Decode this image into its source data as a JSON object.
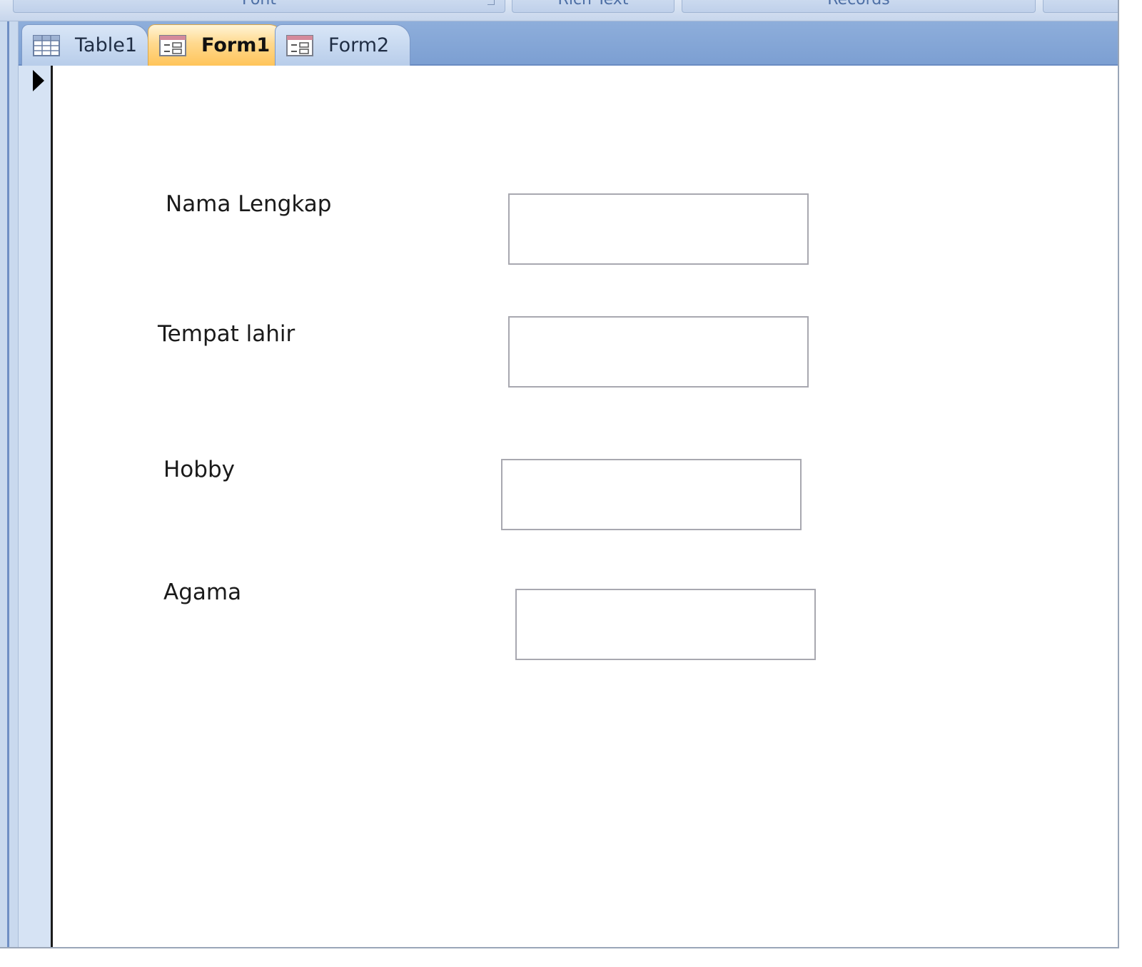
{
  "ribbon": {
    "groups": [
      "Font",
      "Rich Text",
      "Records"
    ]
  },
  "tabs": [
    {
      "label": "Table1",
      "icon": "table-icon",
      "active": false
    },
    {
      "label": "Form1",
      "icon": "form-icon",
      "active": true
    },
    {
      "label": "Form2",
      "icon": "form-icon",
      "active": false
    }
  ],
  "form": {
    "fields": [
      {
        "label": "Nama Lengkap",
        "value": ""
      },
      {
        "label": "Tempat lahir",
        "value": ""
      },
      {
        "label": "Hobby",
        "value": ""
      },
      {
        "label": "Agama",
        "value": ""
      }
    ]
  },
  "colors": {
    "tab_active": "#ffc45a",
    "tabbar": "#7c9fd2",
    "selector": "#d6e3f4"
  }
}
